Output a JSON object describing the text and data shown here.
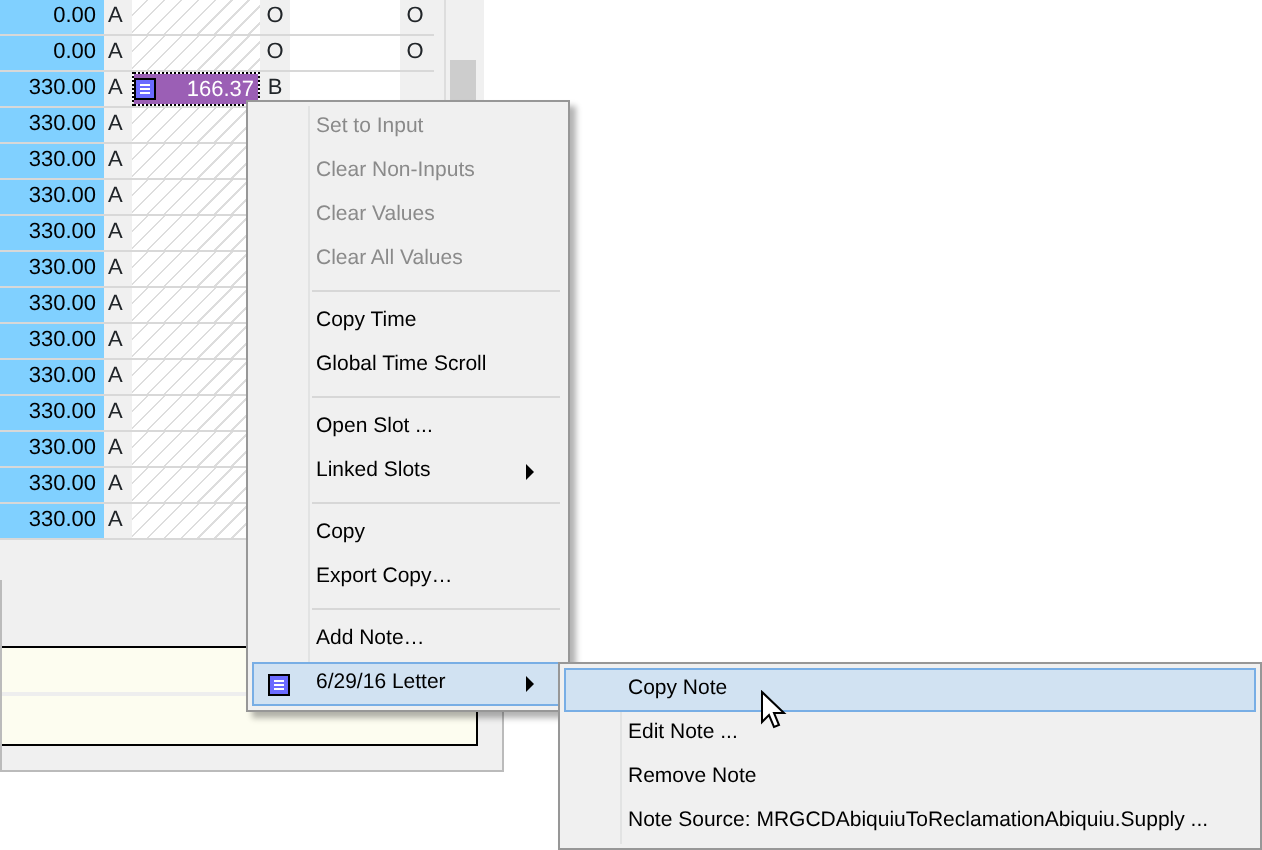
{
  "grid": {
    "rows": [
      {
        "value": "0.00",
        "flag": "A",
        "cells": [
          {
            "kind": "blank"
          },
          {
            "kind": "text",
            "text": "O"
          },
          {
            "kind": "blank"
          },
          {
            "kind": "text",
            "text": "O"
          }
        ]
      },
      {
        "value": "0.00",
        "flag": "A",
        "cells": [
          {
            "kind": "blank"
          },
          {
            "kind": "text",
            "text": "O"
          },
          {
            "kind": "blank"
          },
          {
            "kind": "text",
            "text": "O"
          }
        ]
      },
      {
        "value": "330.00",
        "flag": "A",
        "cells": [
          {
            "kind": "note",
            "text": "166.37",
            "selected": true
          },
          {
            "kind": "text",
            "text": "B"
          }
        ]
      },
      {
        "value": "330.00",
        "flag": "A",
        "cells": []
      },
      {
        "value": "330.00",
        "flag": "A",
        "cells": []
      },
      {
        "value": "330.00",
        "flag": "A",
        "cells": []
      },
      {
        "value": "330.00",
        "flag": "A",
        "cells": []
      },
      {
        "value": "330.00",
        "flag": "A",
        "cells": []
      },
      {
        "value": "330.00",
        "flag": "A",
        "cells": []
      },
      {
        "value": "330.00",
        "flag": "A",
        "cells": []
      },
      {
        "value": "330.00",
        "flag": "A",
        "cells": []
      },
      {
        "value": "330.00",
        "flag": "A",
        "cells": []
      },
      {
        "value": "330.00",
        "flag": "A",
        "cells": []
      },
      {
        "value": "330.00",
        "flag": "A",
        "cells": []
      },
      {
        "value": "330.00",
        "flag": "A",
        "cells": []
      }
    ]
  },
  "context_menu": {
    "items": [
      {
        "kind": "item",
        "label": "Set to Input",
        "disabled": true,
        "submenu": false,
        "selected": false
      },
      {
        "kind": "item",
        "label": "Clear Non-Inputs",
        "disabled": true,
        "submenu": false,
        "selected": false
      },
      {
        "kind": "item",
        "label": "Clear Values",
        "disabled": true,
        "submenu": false,
        "selected": false
      },
      {
        "kind": "item",
        "label": "Clear All Values",
        "disabled": true,
        "submenu": false,
        "selected": false
      },
      {
        "kind": "separator"
      },
      {
        "kind": "item",
        "label": "Copy Time",
        "disabled": false,
        "submenu": false,
        "selected": false
      },
      {
        "kind": "item",
        "label": "Global Time Scroll",
        "disabled": false,
        "submenu": false,
        "selected": false
      },
      {
        "kind": "separator"
      },
      {
        "kind": "item",
        "label": "Open Slot ...",
        "disabled": false,
        "submenu": false,
        "selected": false
      },
      {
        "kind": "item",
        "label": "Linked Slots",
        "disabled": false,
        "submenu": true,
        "selected": false
      },
      {
        "kind": "separator"
      },
      {
        "kind": "item",
        "label": "Copy",
        "disabled": false,
        "submenu": false,
        "selected": false
      },
      {
        "kind": "item",
        "label": "Export Copy…",
        "disabled": false,
        "submenu": false,
        "selected": false
      },
      {
        "kind": "separator"
      },
      {
        "kind": "item",
        "label": "Add Note…",
        "disabled": false,
        "submenu": false,
        "selected": false
      },
      {
        "kind": "note",
        "label": "6/29/16 Letter",
        "disabled": false,
        "submenu": true,
        "selected": true
      }
    ]
  },
  "submenu": {
    "items": [
      {
        "label": "Copy Note",
        "selected": true
      },
      {
        "label": "Edit Note ...",
        "selected": false
      },
      {
        "label": "Remove Note",
        "selected": false
      },
      {
        "label": "Note Source: MRGCDAbiquiuToReclamationAbiquiu.Supply ...",
        "selected": false
      }
    ]
  }
}
